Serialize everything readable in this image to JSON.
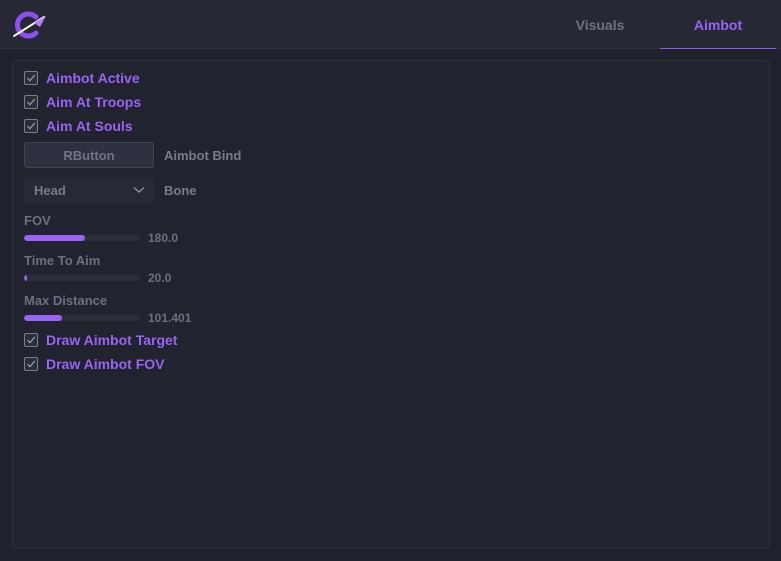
{
  "header": {
    "tabs": [
      {
        "label": "Visuals",
        "active": false
      },
      {
        "label": "Aimbot",
        "active": true
      }
    ]
  },
  "checkboxes": {
    "aimbot_active": {
      "label": "Aimbot Active",
      "checked": true
    },
    "aim_troops": {
      "label": "Aim At Troops",
      "checked": true
    },
    "aim_souls": {
      "label": "Aim At Souls",
      "checked": true
    },
    "draw_target": {
      "label": "Draw Aimbot Target",
      "checked": true
    },
    "draw_fov": {
      "label": "Draw Aimbot FOV",
      "checked": true
    }
  },
  "bind": {
    "button_label": "RButton",
    "label": "Aimbot Bind"
  },
  "bone": {
    "selected": "Head",
    "label": "Bone"
  },
  "sliders": {
    "fov": {
      "label": "FOV",
      "value": "180.0",
      "fill_fraction": 0.53
    },
    "time_to_aim": {
      "label": "Time To Aim",
      "value": "20.0",
      "fill_fraction": 0.03
    },
    "max_distance": {
      "label": "Max Distance",
      "value": "101.401",
      "fill_fraction": 0.33
    }
  },
  "colors": {
    "accent": "#9a63f5",
    "background": "#1f222c",
    "topbar": "#262933",
    "muted_text": "#787c89"
  }
}
